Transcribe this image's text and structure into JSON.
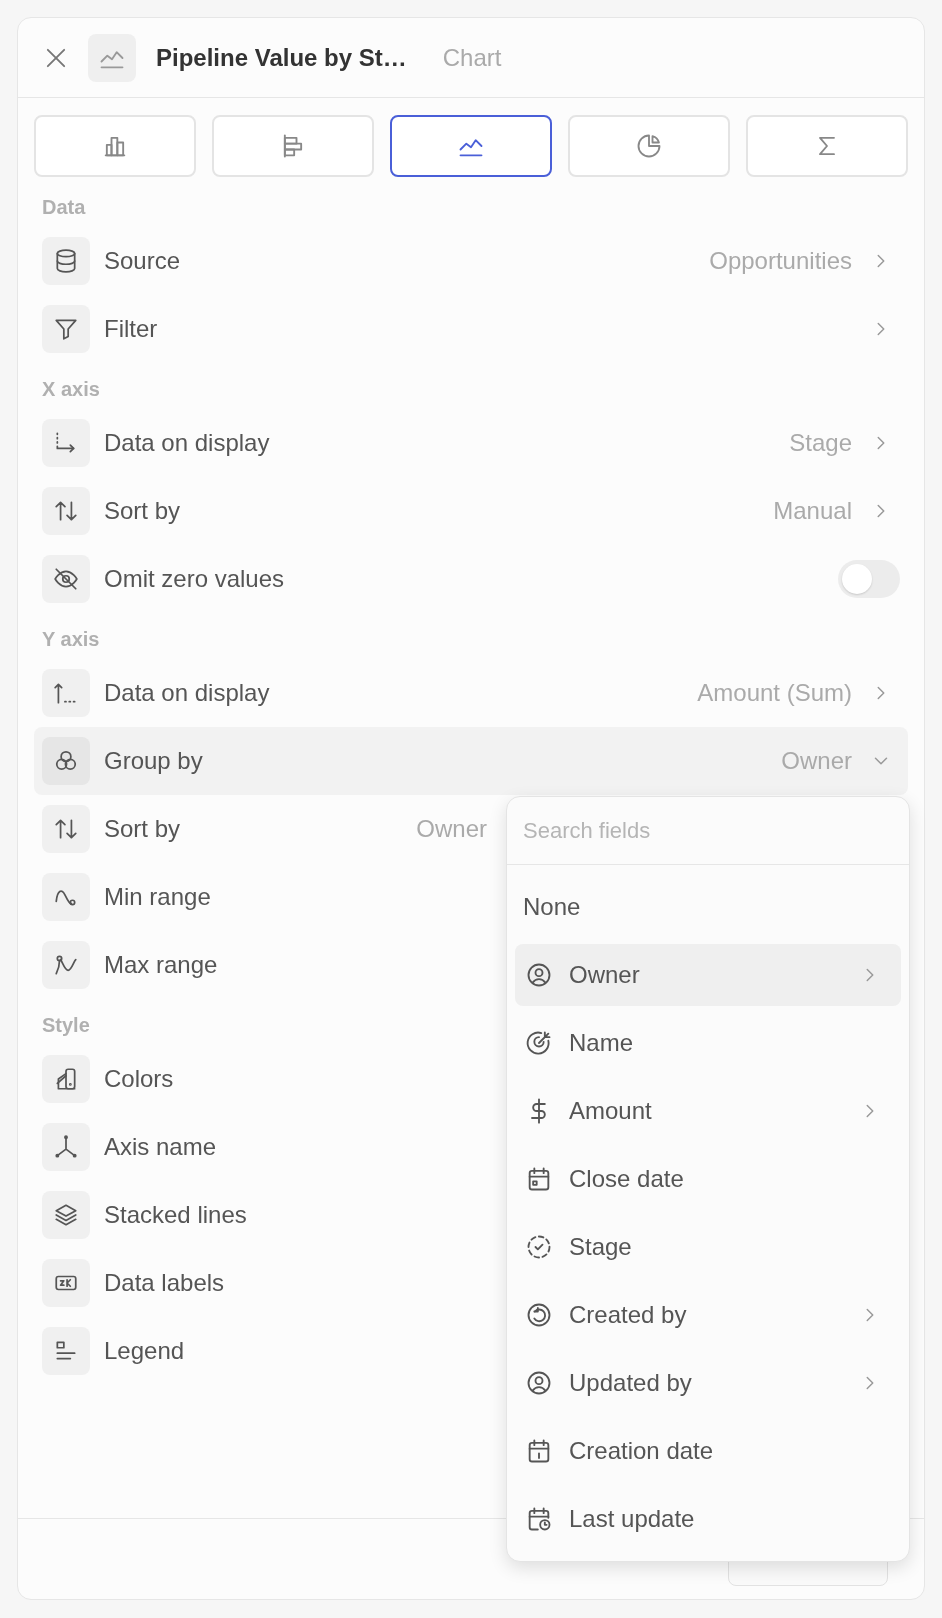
{
  "header": {
    "title": "Pipeline Value by St…",
    "subtitle": "Chart"
  },
  "chart_types": [
    {
      "kind": "column",
      "selected": false
    },
    {
      "kind": "bar",
      "selected": false
    },
    {
      "kind": "line",
      "selected": true
    },
    {
      "kind": "pie",
      "selected": false
    },
    {
      "kind": "total",
      "selected": false
    }
  ],
  "sections": [
    {
      "title": "Data",
      "rows": [
        {
          "kind": "link",
          "label": "Source",
          "value": "Opportunities"
        },
        {
          "kind": "link",
          "label": "Filter"
        }
      ]
    },
    {
      "title": "X axis",
      "rows": [
        {
          "kind": "link",
          "label": "Data on display",
          "value": "Stage"
        },
        {
          "kind": "link",
          "label": "Sort by",
          "value": "Manual"
        },
        {
          "kind": "toggle",
          "label": "Omit zero values",
          "on": false
        }
      ]
    },
    {
      "title": "Y axis",
      "rows": [
        {
          "kind": "link",
          "label": "Data on display",
          "value": "Amount (Sum)"
        },
        {
          "kind": "select",
          "label": "Group by",
          "value": "Owner",
          "expanded": true
        },
        {
          "kind": "plain",
          "label": "Sort by",
          "value": "Owner"
        },
        {
          "kind": "plain",
          "label": "Min range"
        },
        {
          "kind": "plain",
          "label": "Max range"
        }
      ]
    },
    {
      "title": "Style",
      "rows": [
        {
          "kind": "plain",
          "label": "Colors"
        },
        {
          "kind": "plain",
          "label": "Axis name"
        },
        {
          "kind": "plain",
          "label": "Stacked lines"
        },
        {
          "kind": "plain",
          "label": "Data labels"
        },
        {
          "kind": "plain",
          "label": "Legend"
        }
      ]
    }
  ],
  "menu": {
    "placeholder": "Search fields",
    "items": [
      {
        "label": "None",
        "selected": false,
        "submenu": false
      },
      {
        "label": "Owner",
        "selected": true,
        "submenu": true
      },
      {
        "label": "Name",
        "selected": false,
        "submenu": false
      },
      {
        "label": "Amount",
        "selected": false,
        "submenu": true
      },
      {
        "label": "Close date",
        "selected": false,
        "submenu": false
      },
      {
        "label": "Stage",
        "selected": false,
        "submenu": false
      },
      {
        "label": "Created by",
        "selected": false,
        "submenu": true
      },
      {
        "label": "Updated by",
        "selected": false,
        "submenu": true
      },
      {
        "label": "Creation date",
        "selected": false,
        "submenu": false
      },
      {
        "label": "Last update",
        "selected": false,
        "submenu": false
      }
    ]
  }
}
